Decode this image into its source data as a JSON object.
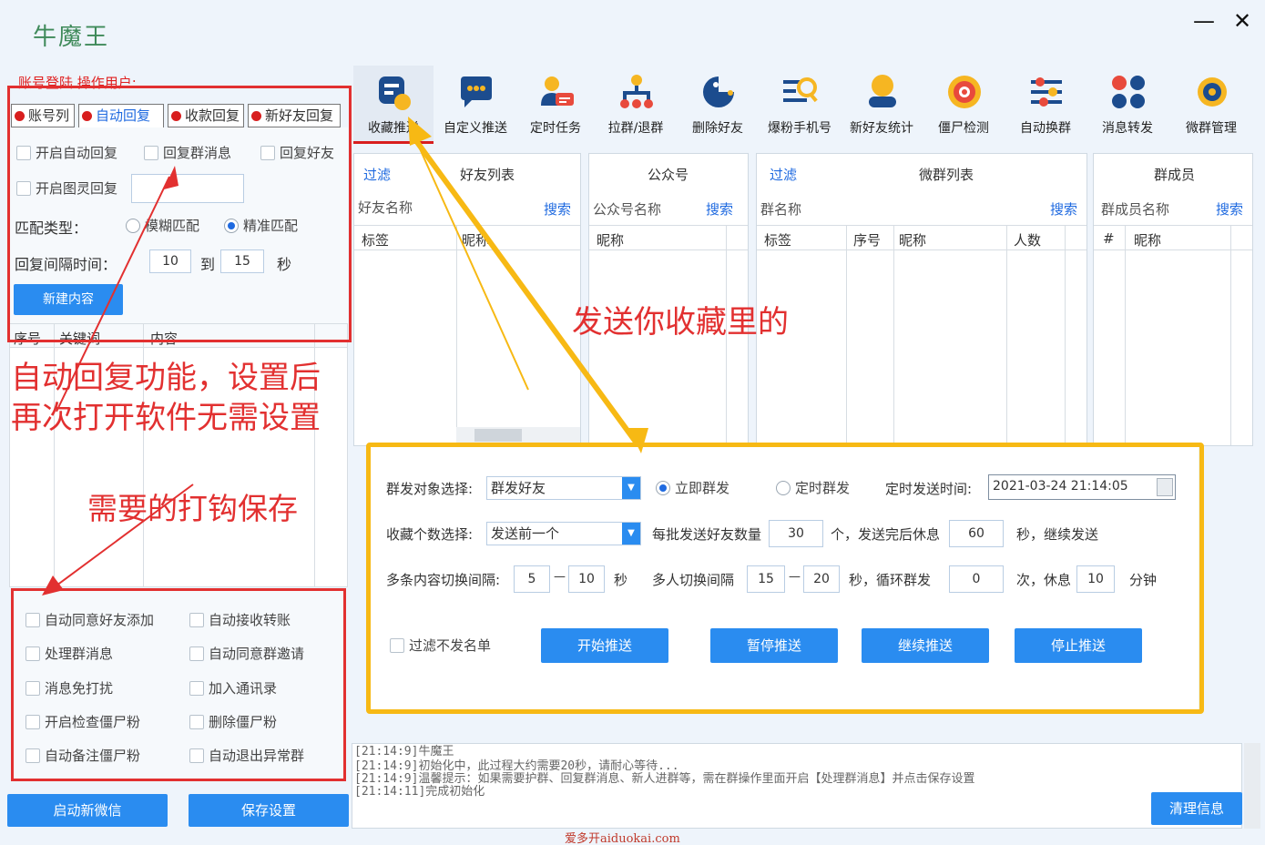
{
  "app": {
    "title": "牛魔王",
    "minimize": "—",
    "close": "✕"
  },
  "login": {
    "label": "账号登陆    操作用户:"
  },
  "left_tabs": [
    {
      "label": "账号列"
    },
    {
      "label": "自动回复"
    },
    {
      "label": "收款回复"
    },
    {
      "label": "新好友回复"
    }
  ],
  "auto_reply": {
    "enable_auto_reply": "开启自动回复",
    "reply_group_msg": "回复群消息",
    "reply_friend": "回复好友",
    "enable_image_reply": "开启图灵回复",
    "match_type_label": "匹配类型：",
    "fuzzy_match": "模糊匹配",
    "exact_match": "精准匹配",
    "interval_label": "回复间隔时间：",
    "interval_from": "10",
    "to_label": "到",
    "interval_to": "15",
    "sec_label": "秒",
    "new_content_button": "新建内容",
    "table_headers": [
      "序号",
      "关键词",
      "内容"
    ]
  },
  "annotations": {
    "auto_reply_note_1": "自动回复功能，设置后",
    "auto_reply_note_2": "再次打开软件无需设置",
    "check_save_note": "需要的打钩保存",
    "favorites_note": "发送你收藏里的"
  },
  "options": [
    "自动同意好友添加",
    "自动接收转账",
    "处理群消息",
    "自动同意群邀请",
    "消息免打扰",
    "加入通讯录",
    "开启检查僵尸粉",
    "删除僵尸粉",
    "自动备注僵尸粉",
    "自动退出异常群"
  ],
  "bottom_buttons": {
    "start_wechat": "启动新微信",
    "save_settings": "保存设置"
  },
  "toolbar": [
    {
      "label": "收藏推送",
      "icon": "favorites-push-icon"
    },
    {
      "label": "自定义推送",
      "icon": "custom-push-icon"
    },
    {
      "label": "定时任务",
      "icon": "scheduled-task-icon"
    },
    {
      "label": "拉群/退群",
      "icon": "group-tree-icon"
    },
    {
      "label": "删除好友",
      "icon": "delete-friend-icon"
    },
    {
      "label": "爆粉手机号",
      "icon": "phone-search-icon"
    },
    {
      "label": "新好友统计",
      "icon": "new-friend-stats-icon"
    },
    {
      "label": "僵尸检测",
      "icon": "zombie-detect-icon"
    },
    {
      "label": "自动换群",
      "icon": "auto-switch-group-icon"
    },
    {
      "label": "消息转发",
      "icon": "message-forward-icon"
    },
    {
      "label": "微群管理",
      "icon": "group-manage-icon"
    }
  ],
  "panels": {
    "friends": {
      "filter": "过滤",
      "title": "好友列表",
      "name_label": "好友名称",
      "search": "搜索",
      "cols": [
        "标签",
        "昵称"
      ]
    },
    "official": {
      "title": "公众号",
      "name_label": "公众号名称",
      "search": "搜索",
      "cols": [
        "昵称"
      ]
    },
    "groups": {
      "filter": "过滤",
      "title": "微群列表",
      "name_label": "群名称",
      "search": "搜索",
      "cols": [
        "标签",
        "序号",
        "昵称",
        "人数"
      ]
    },
    "members": {
      "title": "群成员",
      "name_label": "群成员名称",
      "search": "搜索",
      "cols": [
        "#",
        "昵称"
      ]
    }
  },
  "push": {
    "target_label": "群发对象选择:",
    "target_value": "群发好友",
    "send_now": "立即群发",
    "send_timed": "定时群发",
    "timed_label": "定时发送时间:",
    "timed_value": "2021-03-24 21:14:05",
    "fav_count_label": "收藏个数选择:",
    "fav_count_value": "发送前一个",
    "batch_label": "每批发送好友数量",
    "batch_value": "30",
    "rest_label": "个，发送完后休息",
    "rest_value": "60",
    "continue_label": "秒，继续发送",
    "multi_label": "多条内容切换间隔:",
    "multi_from": "5",
    "multi_to": "10",
    "multi_unit": "秒",
    "person_label": "多人切换间隔",
    "person_from": "15",
    "person_to": "20",
    "loop_label": "秒，循环群发",
    "loop_value": "0",
    "times_label": "次，休息",
    "rest_min": "10",
    "min_label": "分钟",
    "dash": "—",
    "filter_label": "过滤不发名单",
    "start": "开始推送",
    "pause": "暂停推送",
    "resume": "继续推送",
    "stop": "停止推送"
  },
  "log": {
    "lines": [
      "[21:14:9]牛魔王",
      "[21:14:9]初始化中，此过程大约需要20秒，请耐心等待...",
      "[21:14:9]温馨提示：如果需要护群、回复群消息、新人进群等，需在群操作里面开启【处理群消息】并点击保存设置",
      "[21:14:11]完成初始化"
    ],
    "clear": "清理信息"
  },
  "watermark": "爱多开aiduokai.com",
  "colors": {
    "accent": "#2a8cf0",
    "annotation_red": "#e23030",
    "annotation_yellow": "#f7b914"
  }
}
